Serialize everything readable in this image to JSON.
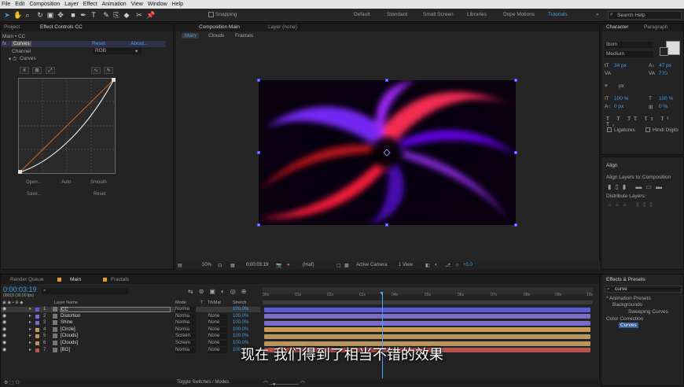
{
  "menu": [
    "File",
    "Edit",
    "Composition",
    "Layer",
    "Effect",
    "Animation",
    "View",
    "Window",
    "Help"
  ],
  "toolbar": {
    "snapping": "Snapping",
    "workspaces": [
      "Default",
      "Standard",
      "Small Screen",
      "Libraries",
      "Dope Motions",
      "Tutorials"
    ],
    "active_workspace": "Tutorials",
    "search_placeholder": "Search Help"
  },
  "left_panel": {
    "tab_project": "Project",
    "tab_effect": "Effect Controls CC",
    "header": "Main • CC",
    "effect_name": "Curves",
    "reset": "Reset",
    "about": "About...",
    "channel_label": "Channel",
    "channel_value": "RGB",
    "curves_label": "Curves",
    "buttons": {
      "open": "Open...",
      "auto": "Auto",
      "smooth": "Smooth",
      "save": "Save...",
      "reset": "Reset"
    }
  },
  "comp": {
    "tab": "Composition Main",
    "layer_tab": "Layer (none)",
    "nav": [
      "Main",
      "Clouds",
      "Fractals"
    ],
    "zoom": "50%",
    "time": "0:00:03:19",
    "resolution": "(Half)",
    "camera": "Active Camera",
    "view": "1 View",
    "exposure": "+0.0"
  },
  "character": {
    "tab": "Character",
    "tab2": "Paragraph",
    "font": "Ibom",
    "style": "Medium",
    "size": "34 px",
    "leading": "47 px",
    "tracking": "770",
    "unit": "px",
    "scale_v": "100 %",
    "scale_h": "100 %",
    "baseline": "0 px",
    "tsume": "0 %",
    "ligatures": "Ligatures",
    "hindi": "Hindi Digits"
  },
  "align": {
    "tab": "Align",
    "align_to_label": "Align Layers to:",
    "align_to_value": "Composition",
    "distribute": "Distribute Layers:"
  },
  "effects": {
    "tab": "Effects & Presets",
    "search": "curve",
    "tree": [
      "* Animation Presets",
      "Backgrounds",
      "Sweeping Curves",
      "Color Correction",
      "Curves"
    ]
  },
  "timeline": {
    "tab_render": "Render Queue",
    "tab_main": "Main",
    "tab_fractals": "Fractals",
    "current_time": "0:00:03:19",
    "fps": "00019 (30.00 fps)",
    "columns": [
      "Layer Name",
      "Mode",
      "T",
      "TrkMat",
      "Stretch"
    ],
    "ruler": [
      "00s",
      "01s",
      "02s",
      "03s",
      "04s",
      "05s",
      "06s",
      "07s",
      "08s",
      "09s",
      "10s"
    ],
    "toggle": "Toggle Switches / Modes",
    "layers": [
      {
        "num": "1",
        "name": "CC",
        "mode": "Norma",
        "trk": "",
        "stretch": "100.0%",
        "color": "#5b5bd6"
      },
      {
        "num": "2",
        "name": "Distortion",
        "mode": "Norma",
        "trk": "None",
        "stretch": "100.0%",
        "color": "#7a6cc8"
      },
      {
        "num": "3",
        "name": "Shine",
        "mode": "Norma",
        "trk": "None",
        "stretch": "100.0%",
        "color": "#7a6cc8"
      },
      {
        "num": "4",
        "name": "[Circle]",
        "mode": "Norma",
        "trk": "None",
        "stretch": "100.0%",
        "color": "#c89a5a"
      },
      {
        "num": "5",
        "name": "[Clouds]",
        "mode": "Screen",
        "trk": "None",
        "stretch": "100.0%",
        "color": "#b8945e"
      },
      {
        "num": "6",
        "name": "[Clouds]",
        "mode": "Screen",
        "trk": "None",
        "stretch": "100.0%",
        "color": "#b8945e"
      },
      {
        "num": "7",
        "name": "[BG]",
        "mode": "Norma",
        "trk": "None",
        "stretch": "100.0%",
        "color": "#b85450"
      }
    ]
  },
  "subtitle": "现在 我们得到了相当不错的效果"
}
